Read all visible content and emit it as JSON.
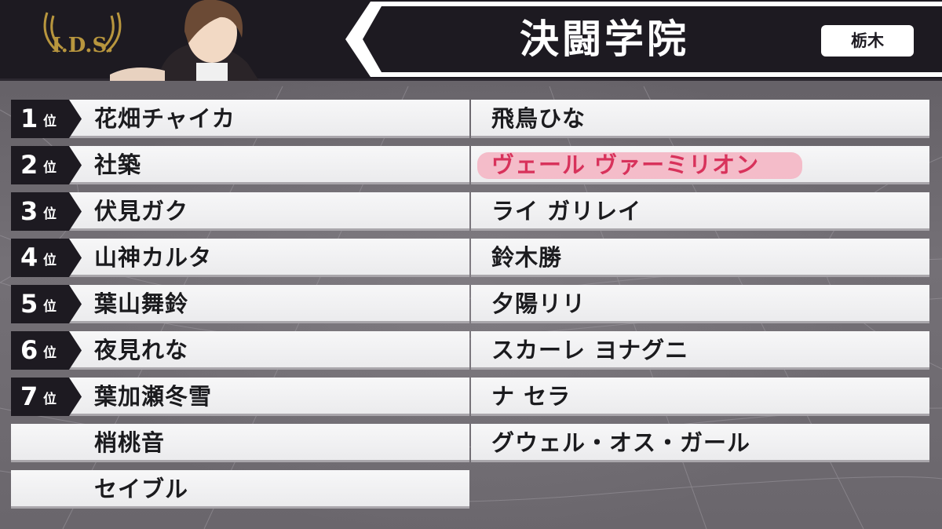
{
  "header": {
    "logo_text": "I.D.S.",
    "school_name": "決闘学院",
    "region": "栃木"
  },
  "ranking": {
    "rank_suffix": "位",
    "left_column": [
      {
        "rank": "1",
        "name": "花畑チャイカ"
      },
      {
        "rank": "2",
        "name": "社築"
      },
      {
        "rank": "3",
        "name": "伏見ガク"
      },
      {
        "rank": "4",
        "name": "山神カルタ"
      },
      {
        "rank": "5",
        "name": "葉山舞鈴"
      },
      {
        "rank": "6",
        "name": "夜見れな"
      },
      {
        "rank": "7",
        "name": "葉加瀬冬雪"
      },
      {
        "rank": "",
        "name": "梢桃音"
      },
      {
        "rank": "",
        "name": "セイブル"
      }
    ],
    "right_column": [
      {
        "name": "飛鳥ひな"
      },
      {
        "name": "ヴェール ヴァーミリオン",
        "highlighted": true
      },
      {
        "name": "ライ ガリレイ"
      },
      {
        "name": "鈴木勝"
      },
      {
        "name": "夕陽リリ"
      },
      {
        "name": "スカーレ ヨナグニ"
      },
      {
        "name": "ナ セラ"
      },
      {
        "name": "グウェル・オス・ガール"
      }
    ]
  },
  "colors": {
    "header_bg": "#1d1a21",
    "row_bg": "#f2f2f4",
    "highlight": "#f4b6c4",
    "highlight_text": "#d8325b",
    "logo_gold": "#b8963e"
  },
  "icons": {
    "logo": "winged-ids-emblem",
    "avatar": "character-portrait"
  }
}
